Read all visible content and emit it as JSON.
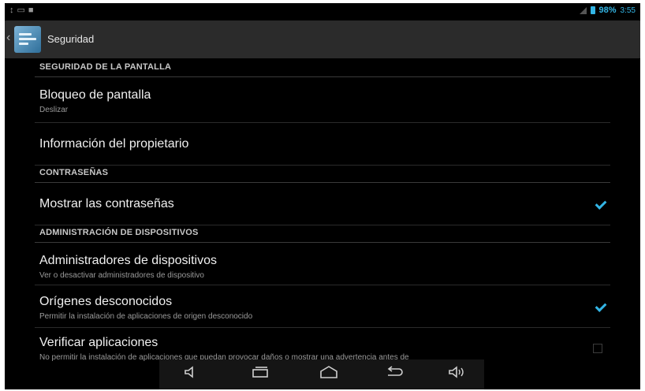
{
  "status_bar": {
    "icons_left": [
      "usb-icon",
      "screenshot-icon",
      "notification-icon"
    ],
    "battery_percent": "98%",
    "time": "3:55",
    "accent": "#33b5e5"
  },
  "action_bar": {
    "title": "Seguridad",
    "icon": "settings-icon"
  },
  "sections": [
    {
      "header": "SEGURIDAD DE LA PANTALLA",
      "items": [
        {
          "title": "Bloqueo de pantalla",
          "subtitle": "Deslizar"
        },
        {
          "title": "Información del propietario"
        }
      ]
    },
    {
      "header": "CONTRASEÑAS",
      "items": [
        {
          "title": "Mostrar las contraseñas",
          "checked": true
        }
      ]
    },
    {
      "header": "ADMINISTRACIÓN DE DISPOSITIVOS",
      "items": [
        {
          "title": "Administradores de dispositivos",
          "subtitle": "Ver o desactivar administradores de dispositivo"
        },
        {
          "title": "Orígenes desconocidos",
          "subtitle": "Permitir la instalación de aplicaciones de origen desconocido",
          "checked": true
        },
        {
          "title": "Verificar aplicaciones",
          "subtitle": "No permitir la instalación de aplicaciones que puedan provocar daños o mostrar una advertencia antes de",
          "checked": false
        }
      ]
    }
  ],
  "nav_bar": {
    "buttons": [
      "volume-down-icon",
      "recent-apps-icon",
      "home-icon",
      "back-icon",
      "volume-up-icon"
    ]
  }
}
